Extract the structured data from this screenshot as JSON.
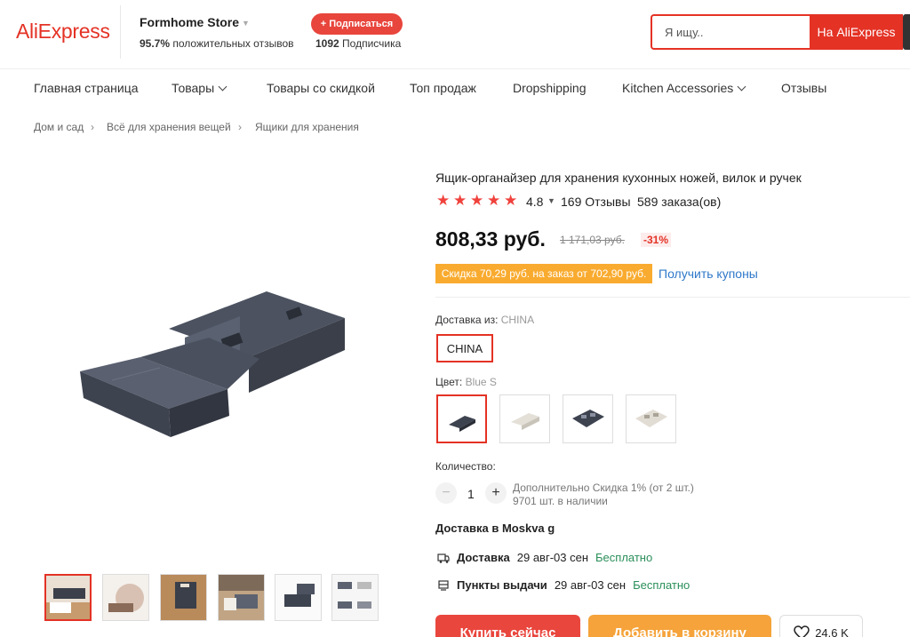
{
  "header": {
    "logo": "AliExpress",
    "store_name": "Formhome Store",
    "store_rating_pct": "95.7%",
    "store_rating_text": "положительных отзывов",
    "subscribe_label": "+ Подписаться",
    "subscribers_count": "1092",
    "subscribers_text": "Подписчика",
    "search_placeholder": "Я ищу..",
    "search_button": "На AliExpress"
  },
  "nav": {
    "items": [
      {
        "label": "Главная страница"
      },
      {
        "label": "Товары"
      },
      {
        "label": "Товары со скидкой"
      },
      {
        "label": "Топ продаж"
      },
      {
        "label": "Dropshipping"
      },
      {
        "label": "Kitchen Accessories"
      },
      {
        "label": "Отзывы"
      }
    ]
  },
  "breadcrumb": [
    "Дом и сад",
    "Всё для хранения вещей",
    "Ящики для хранения"
  ],
  "product": {
    "title": "Ящик-органайзер для хранения кухонных ножей, вилок и ручек",
    "rating": "4.8",
    "stars": 5,
    "reviews": "169 Отзывы",
    "orders": "589 заказа(ов)",
    "price": "808,33 руб.",
    "old_price": "1 171,03 руб.",
    "discount": "-31%",
    "coupon": "Скидка 70,29 руб. на заказ от 702,90 руб.",
    "coupon_link": "Получить купоны",
    "ship_from_label": "Доставка из:",
    "ship_from_value": "CHINA",
    "ship_option": "CHINA",
    "color_label": "Цвет:",
    "color_value": "Blue S",
    "quantity_label": "Количество:",
    "quantity": "1",
    "qty_minus": "−",
    "qty_plus": "+",
    "bulk_discount": "Дополнительно Скидка 1% (от 2 шт.)",
    "stock": "9701 шт. в наличии",
    "delivery_title": "Доставка в Moskva g",
    "delivery_label": "Доставка",
    "delivery_dates": "29 авг-03 сен",
    "delivery_price": "Бесплатно",
    "pickup_label": "Пункты выдачи",
    "pickup_dates": "29 авг-03 сен",
    "pickup_price": "Бесплатно",
    "buy_now": "Купить сейчас",
    "add_to_cart": "Добавить в корзину",
    "wishlist_count": "24.6 K"
  },
  "colors": {
    "accent": "#e43225",
    "coupon_bg": "#f9ab2f",
    "link": "#2e78c9",
    "free_text": "#2a8f5a",
    "cart_button": "#f5a33a"
  }
}
